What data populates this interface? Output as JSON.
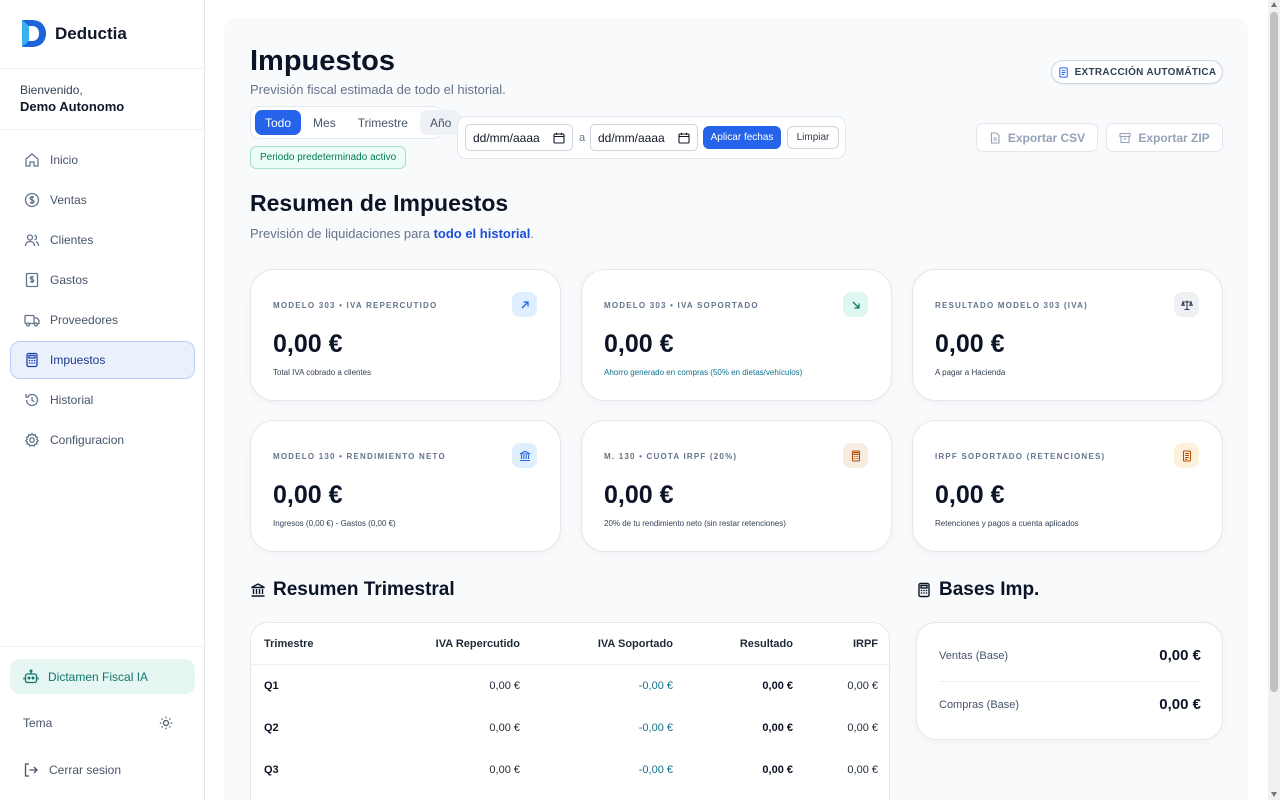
{
  "brand": {
    "name": "Deductia"
  },
  "user": {
    "welcome": "Bienvenido,",
    "name": "Demo Autonomo"
  },
  "sidebar": {
    "items": [
      {
        "label": "Inicio",
        "icon": "home-icon"
      },
      {
        "label": "Ventas",
        "icon": "dollar-icon"
      },
      {
        "label": "Clientes",
        "icon": "users-icon"
      },
      {
        "label": "Gastos",
        "icon": "receipt-icon"
      },
      {
        "label": "Proveedores",
        "icon": "truck-icon"
      },
      {
        "label": "Impuestos",
        "icon": "calculator-icon",
        "active": true
      },
      {
        "label": "Historial",
        "icon": "history-icon"
      },
      {
        "label": "Configuracion",
        "icon": "gear-icon"
      }
    ],
    "dictamen": "Dictamen Fiscal IA",
    "theme": "Tema",
    "logout": "Cerrar sesion"
  },
  "header": {
    "title": "Impuestos",
    "subtitle": "Previsión fiscal estimada de todo el historial.",
    "extract_button": "EXTRACCIÓN AUTOMÁTICA"
  },
  "filters": {
    "periods": [
      "Todo",
      "Mes",
      "Trimestre",
      "Año"
    ],
    "active_period": "Todo",
    "badge": "Periodo predeterminado activo",
    "date_from": "dd/mm/aaaa",
    "date_to": "dd/mm/aaaa",
    "separator": "a",
    "apply": "Aplicar fechas",
    "clear": "Limpiar"
  },
  "exports": {
    "csv": "Exportar CSV",
    "zip": "Exportar ZIP"
  },
  "summary": {
    "title": "Resumen de Impuestos",
    "sub_prefix": "Previsión de liquidaciones para ",
    "sub_highlight": "todo el historial",
    "sub_suffix": "."
  },
  "cards": [
    {
      "label": "MODELO 303 • IVA REPERCUTIDO",
      "value": "0,00 €",
      "note": "Total IVA cobrado a clientes",
      "icon": "arrow-up-right-icon",
      "icon_bg": "#e0efff",
      "icon_color": "#2563eb"
    },
    {
      "label": "MODELO 303 • IVA SOPORTADO",
      "value": "0,00 €",
      "note": "Ahorro generado en compras (50% en dietas/vehículos)",
      "icon": "arrow-down-right-icon",
      "icon_bg": "#dff7f1",
      "icon_color": "#0f766e"
    },
    {
      "label": "RESULTADO MODELO 303 (IVA)",
      "value": "0,00 €",
      "note": "A pagar a Hacienda",
      "icon": "scale-icon",
      "icon_bg": "#eef0f3",
      "icon_color": "#334155"
    },
    {
      "label": "MODELO 130 • RENDIMIENTO NETO",
      "value": "0,00 €",
      "note": "Ingresos (0,00 €) - Gastos (0,00 €)",
      "icon": "bank-icon",
      "icon_bg": "#e0efff",
      "icon_color": "#2563eb"
    },
    {
      "label": "M. 130 • CUOTA IRPF (20%)",
      "value": "0,00 €",
      "note": "20% de tu rendimiento neto (sin restar retenciones)",
      "icon": "calculator-icon",
      "icon_bg": "#f6ece0",
      "icon_color": "#b45309"
    },
    {
      "label": "IRPF SOPORTADO (RETENCIONES)",
      "value": "0,00 €",
      "note": "Retenciones y pagos a cuenta aplicados",
      "icon": "receipt-icon",
      "icon_bg": "#fdf1dc",
      "icon_color": "#b45309"
    }
  ],
  "quarterly": {
    "title": "Resumen Trimestral",
    "columns": [
      "Trimestre",
      "IVA Repercutido",
      "IVA Soportado",
      "Resultado",
      "IRPF"
    ],
    "rows": [
      [
        "Q1",
        "0,00 €",
        "-0,00 €",
        "0,00 €",
        "0,00 €"
      ],
      [
        "Q2",
        "0,00 €",
        "-0,00 €",
        "0,00 €",
        "0,00 €"
      ],
      [
        "Q3",
        "0,00 €",
        "-0,00 €",
        "0,00 €",
        "0,00 €"
      ]
    ]
  },
  "bases": {
    "title": "Bases Imp.",
    "rows": [
      {
        "label": "Ventas (Base)",
        "value": "0,00 €"
      },
      {
        "label": "Compras (Base)",
        "value": "0,00 €"
      }
    ]
  },
  "colors": {
    "accent": "#2563eb",
    "teal": "#0e7490",
    "sidebar_active_bg": "#eaf1fd"
  }
}
